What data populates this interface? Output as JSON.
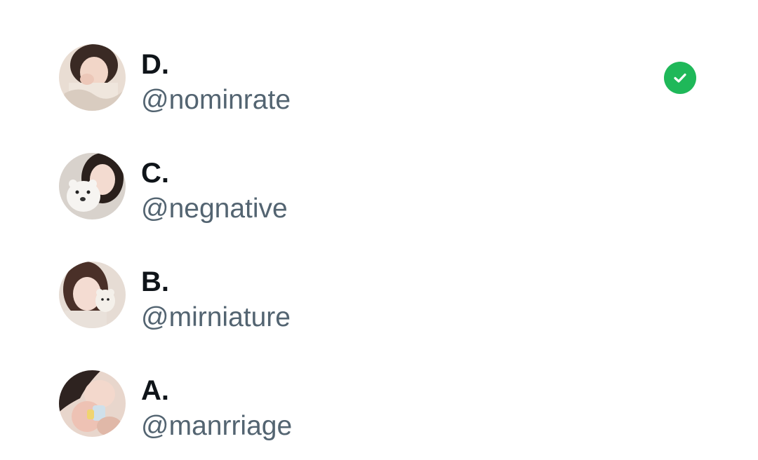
{
  "accounts": [
    {
      "name": "D.",
      "handle": "@nominrate",
      "selected": true
    },
    {
      "name": "C.",
      "handle": "@negnative",
      "selected": false
    },
    {
      "name": "B.",
      "handle": "@mirniature",
      "selected": false
    },
    {
      "name": "A.",
      "handle": "@manrriage",
      "selected": false
    }
  ],
  "colors": {
    "name_text": "#0f1419",
    "handle_text": "#536471",
    "selected_check": "#1fb859",
    "background": "#ffffff"
  },
  "icons": {
    "selected": "checkmark-circle-icon"
  }
}
